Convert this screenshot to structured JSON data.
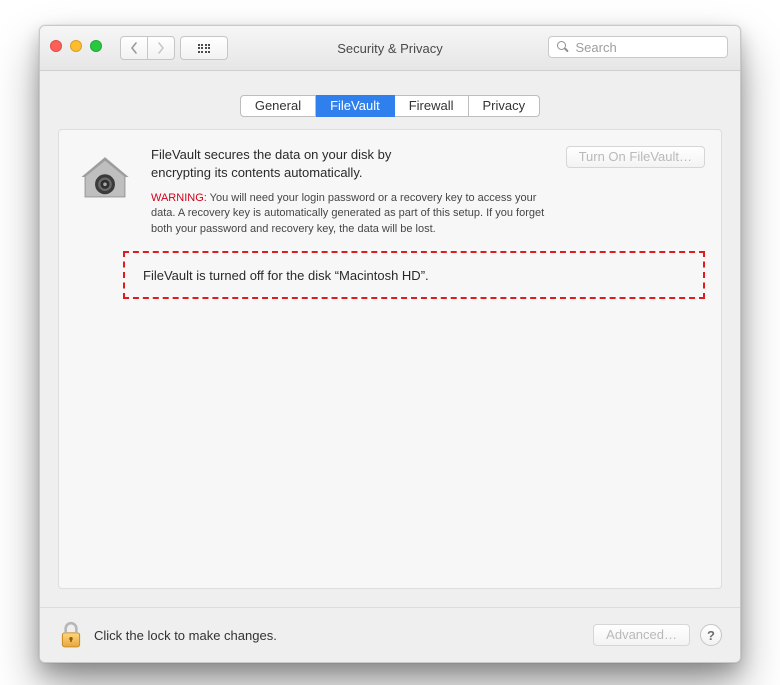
{
  "titlebar": {
    "title": "Security & Privacy",
    "search_placeholder": "Search"
  },
  "tabs": {
    "general": "General",
    "filevault": "FileVault",
    "firewall": "Firewall",
    "privacy": "Privacy",
    "active": "filevault"
  },
  "filevault": {
    "description": "FileVault secures the data on your disk by encrypting its contents automatically.",
    "turn_on_label": "Turn On FileVault…",
    "warning_label": "WARNING:",
    "warning_text": "You will need your login password or a recovery key to access your data. A recovery key is automatically generated as part of this setup. If you forget both your password and recovery key, the data will be lost.",
    "status_text": "FileVault is turned off for the disk “Macintosh HD”."
  },
  "footer": {
    "lock_text": "Click the lock to make changes.",
    "advanced_label": "Advanced…",
    "help_label": "?"
  }
}
